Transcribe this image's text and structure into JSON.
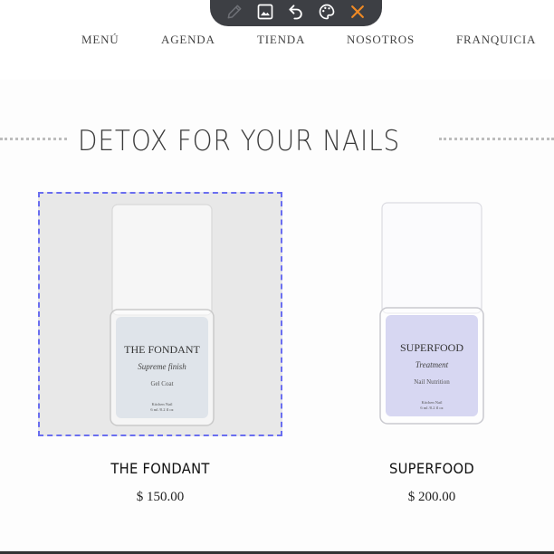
{
  "toolbar": {
    "icons": [
      "pencil-icon",
      "image-icon",
      "undo-icon",
      "palette-icon",
      "close-icon"
    ],
    "accent": "#f08a24"
  },
  "nav": {
    "items": [
      "MENÚ",
      "AGENDA",
      "TIENDA",
      "NOSOTROS",
      "FRANQUICIA"
    ]
  },
  "section": {
    "title": "DETOX FOR YOUR NAILS"
  },
  "products": [
    {
      "name": "THE FONDANT",
      "price": "$ 150.00",
      "label": {
        "brand": "THE FONDANT",
        "script": "Supreme finish",
        "subtitle": "Gel Coat",
        "footer1": "Kitchen Nail",
        "footer2": "6 ml /0.2 fl oz"
      },
      "liquid_color": "#dfe4ea",
      "selected": true
    },
    {
      "name": "SUPERFOOD",
      "price": "$ 200.00",
      "label": {
        "brand": "SUPERFOOD",
        "script": "Treatment",
        "subtitle": "Nail Nutrition",
        "footer1": "Kitchen Nail",
        "footer2": "6 ml /0.2 fl oz"
      },
      "liquid_color": "#d7d7f2",
      "selected": false
    }
  ]
}
